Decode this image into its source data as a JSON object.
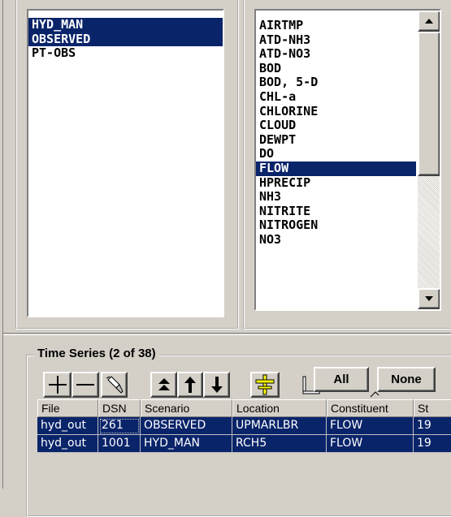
{
  "scenario_list": {
    "items": [
      {
        "label": "HYD_MAN",
        "selected": true
      },
      {
        "label": "OBSERVED",
        "selected": true
      },
      {
        "label": "PT-OBS",
        "selected": false
      }
    ]
  },
  "constituent_list": {
    "items": [
      {
        "label": "AIRTMP",
        "selected": false
      },
      {
        "label": "ATD-NH3",
        "selected": false
      },
      {
        "label": "ATD-NO3",
        "selected": false
      },
      {
        "label": "BOD",
        "selected": false
      },
      {
        "label": "BOD, 5-D",
        "selected": false
      },
      {
        "label": "CHL-a",
        "selected": false
      },
      {
        "label": "CHLORINE",
        "selected": false
      },
      {
        "label": "CLOUD",
        "selected": false
      },
      {
        "label": "DEWPT",
        "selected": false
      },
      {
        "label": "DO",
        "selected": false
      },
      {
        "label": "FLOW",
        "selected": true
      },
      {
        "label": "HPRECIP",
        "selected": false
      },
      {
        "label": "NH3",
        "selected": false
      },
      {
        "label": "NITRITE",
        "selected": false
      },
      {
        "label": "NITROGEN",
        "selected": false
      },
      {
        "label": "NO3",
        "selected": false
      }
    ]
  },
  "time_series": {
    "group_label": "Time Series (2 of 38)",
    "all_label": "All",
    "none_label": "None",
    "columns": [
      "File",
      "DSN",
      "Scenario",
      "Location",
      "Constituent",
      "St"
    ],
    "rows": [
      [
        "hyd_out",
        "261",
        "OBSERVED",
        "UPMARLBR",
        "FLOW",
        "19"
      ],
      [
        "hyd_out",
        "1001",
        "HYD_MAN",
        "RCH5",
        "FLOW",
        "19"
      ]
    ]
  },
  "toolbar": {
    "icons": [
      "add-icon",
      "remove-icon",
      "clear-icon",
      "move-top-icon",
      "move-up-icon",
      "move-down-icon",
      "date-icon",
      "list-view-icon"
    ]
  },
  "colors": {
    "selection": "#0a246a",
    "face": "#d4d0c8"
  }
}
